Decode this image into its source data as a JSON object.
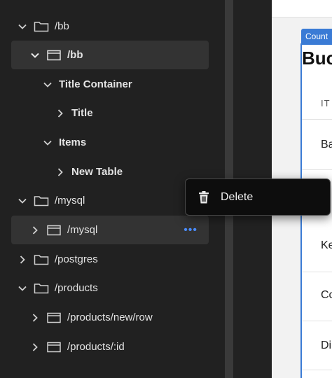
{
  "tree": {
    "items": [
      {
        "label": "/bb",
        "type": "folder",
        "expanded": true,
        "selected": false
      },
      {
        "label": "/bb",
        "type": "screen",
        "expanded": true,
        "selected": true
      },
      {
        "label": "Title Container",
        "type": "component",
        "expanded": true
      },
      {
        "label": "Title",
        "type": "component",
        "expanded": false
      },
      {
        "label": "Items",
        "type": "component",
        "expanded": true
      },
      {
        "label": "New Table",
        "type": "component",
        "expanded": false
      },
      {
        "label": "/mysql",
        "type": "folder",
        "expanded": true
      },
      {
        "label": "/mysql",
        "type": "screen",
        "expanded": false,
        "selected": true,
        "more": "•••"
      },
      {
        "label": "/postgres",
        "type": "folder",
        "expanded": false
      },
      {
        "label": "/products",
        "type": "folder",
        "expanded": true
      },
      {
        "label": "/products/new/row",
        "type": "screen",
        "expanded": false
      },
      {
        "label": "/products/:id",
        "type": "screen",
        "expanded": false
      }
    ]
  },
  "context_menu": {
    "items": [
      {
        "label": "Delete",
        "icon": "trash-icon"
      }
    ]
  },
  "preview": {
    "component_tag": "Count",
    "title": "Buc",
    "column_header": "IT",
    "cells": [
      "Ba",
      "Ke",
      "Co",
      "Di"
    ]
  },
  "colors": {
    "sidebar_bg": "#212121",
    "selected_row": "#333333",
    "accent": "#3a7bd5",
    "more_dots": "#4a8cff",
    "menu_bg": "#0d0d0d"
  }
}
